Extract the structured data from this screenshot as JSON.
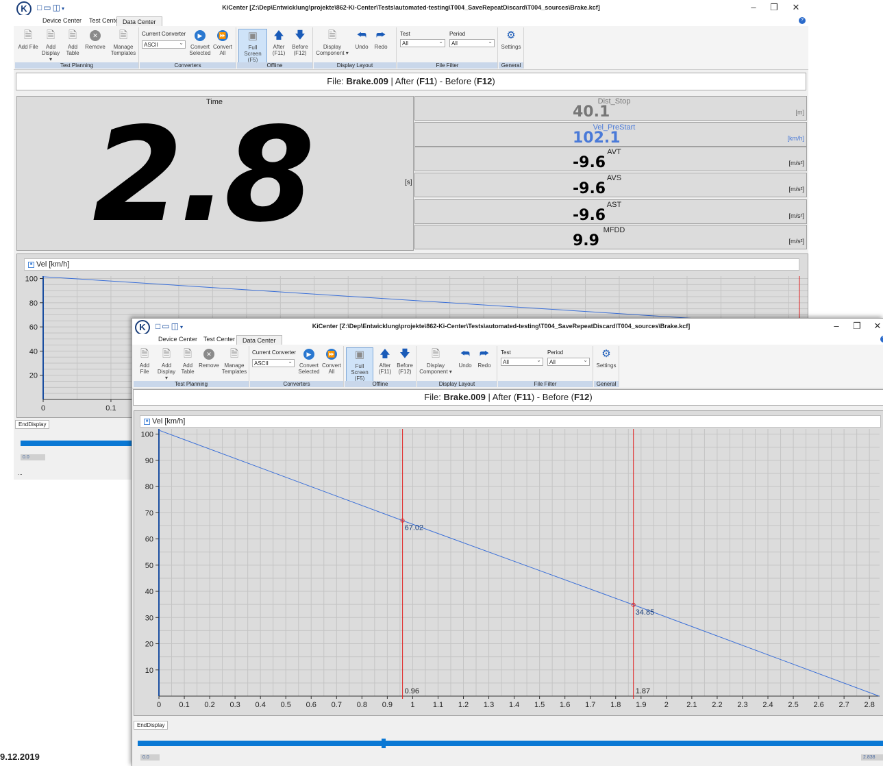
{
  "window": {
    "title": "KiCenter [Z:\\Dep\\Entwicklung\\projekte\\862-Ki-Center\\Tests\\automated-testing\\T004_SaveRepeatDiscard\\T004_sources\\Brake.kcf]",
    "logo_letter": "K",
    "minimize": "–",
    "restore": "❐",
    "close": "✕",
    "help": "?"
  },
  "tabs": [
    "Device Center",
    "Test Center",
    "Data Center"
  ],
  "ribbon": {
    "test_planning": {
      "caption": "Test Planning",
      "add_file": "Add File",
      "add_display": "Add Display ▾",
      "add_table": "Add Table",
      "remove": "Remove",
      "manage_templates": "Manage Templates"
    },
    "converters": {
      "caption": "Converters",
      "current_converter_label": "Current Converter",
      "current_converter_value": "ASCII",
      "convert_selected": "Convert Selected",
      "convert_all": "Convert All"
    },
    "offline": {
      "caption": "Offline",
      "full_screen": "Full Screen (F5)",
      "after": "After (F11)",
      "before": "Before (F12)"
    },
    "display_layout": {
      "caption": "Display Layout",
      "display_component": "Display Component ▾",
      "undo": "Undo",
      "redo": "Redo"
    },
    "file_filter": {
      "caption": "File Filter",
      "test_label": "Test",
      "test_value": "All",
      "period_label": "Period",
      "period_value": "All"
    },
    "general": {
      "caption": "General",
      "settings": "Settings"
    }
  },
  "file_bar": {
    "prefix": "File: ",
    "filename": "Brake.009",
    "sep": " | After (",
    "key_after": "F11",
    "mid": ") - Before (",
    "key_before": "F12",
    "suffix": ")"
  },
  "time_panel": {
    "title": "Time",
    "value": "2.8",
    "unit": "[s]"
  },
  "metrics": [
    {
      "name": "Dist_Stop",
      "value": "40.1",
      "unit": "[m]",
      "style": "muted"
    },
    {
      "name": "Vel_PreStart",
      "value": "102.1",
      "unit": "[km/h]",
      "style": "blue"
    },
    {
      "name": "AVT",
      "value": "-9.6",
      "unit": "[m/s²]",
      "style": "normal"
    },
    {
      "name": "AVS",
      "value": "-9.6",
      "unit": "[m/s²]",
      "style": "normal"
    },
    {
      "name": "AST",
      "value": "-9.6",
      "unit": "[m/s²]",
      "style": "normal"
    },
    {
      "name": "MFDD",
      "value": "9.9",
      "unit": "[m/s²]",
      "style": "normal"
    }
  ],
  "chart_data": [
    {
      "type": "line",
      "title": "",
      "legend": [
        "Vel [km/h]"
      ],
      "series": [
        {
          "name": "Vel [km/h]",
          "x": [
            0,
            0.96,
            1.87,
            2.838
          ],
          "y": [
            101.5,
            67.02,
            34.85,
            0
          ],
          "color": "#3a6fd8"
        }
      ],
      "xlim": [
        0,
        2.84
      ],
      "ylim": [
        0,
        102
      ],
      "xticks": [
        "0",
        "0.1",
        "0.2",
        "0.3"
      ],
      "yticks": [
        "100",
        "80",
        "60",
        "40",
        "20"
      ],
      "grid": true
    },
    {
      "type": "line",
      "title": "",
      "legend": [
        "Vel [km/h]"
      ],
      "series": [
        {
          "name": "Vel [km/h]",
          "x": [
            0,
            0.96,
            1.87,
            2.838
          ],
          "y": [
            101.5,
            67.02,
            34.85,
            0
          ],
          "color": "#3a6fd8"
        }
      ],
      "xlim": [
        0,
        2.84
      ],
      "ylim": [
        0,
        102
      ],
      "xticks": [
        "0",
        "0.1",
        "0.2",
        "0.3",
        "0.4",
        "0.5",
        "0.6",
        "0.7",
        "0.8",
        "0.9",
        "1",
        "1.1",
        "1.2",
        "1.3",
        "1.4",
        "1.5",
        "1.6",
        "1.7",
        "1.8",
        "1.9",
        "2",
        "2.1",
        "2.2",
        "2.3",
        "2.4",
        "2.5",
        "2.6",
        "2.7",
        "2.8"
      ],
      "yticks": [
        "100",
        "90",
        "80",
        "70",
        "60",
        "50",
        "40",
        "30",
        "20",
        "10"
      ],
      "grid": true,
      "cursors": [
        {
          "x": 0.96,
          "y_label": "67.02",
          "x_label": "0.96"
        },
        {
          "x": 1.87,
          "y_label": "34.85",
          "x_label": "1.87"
        }
      ]
    }
  ],
  "end_display": {
    "tab": "EndDisplay",
    "start_value": "0.0",
    "end_value": "2.838",
    "thumb_position": 0.33,
    "dots": "..."
  },
  "date_stamp": "9.12.2019",
  "colors": {
    "accent": "#0a78d4",
    "cursor": "#e02020",
    "line": "#3a6fd8",
    "ribbon_caption": "#c9d7ea"
  }
}
